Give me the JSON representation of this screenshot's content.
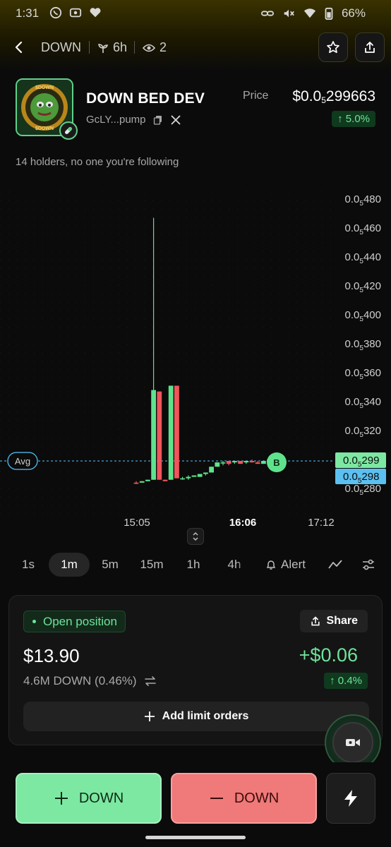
{
  "status_bar": {
    "time": "1:31",
    "battery": "66%",
    "left_icons": [
      "whatsapp-icon",
      "media-icon",
      "heart-icon"
    ],
    "right_icons": [
      "link-icon",
      "mute-icon",
      "wifi-icon",
      "battery-icon"
    ]
  },
  "header": {
    "ticker": "DOWN",
    "age": "6h",
    "watchers": "2",
    "buttons": [
      "back-icon",
      "star-icon",
      "share-icon"
    ]
  },
  "token": {
    "name": "DOWN BED DEV",
    "address": "GcLY...pump",
    "logo_text_top": "$DOWN",
    "logo_text_bottom": "$DOWN",
    "price_label": "Price",
    "price_prefix": "$0.0",
    "price_subscript": "5",
    "price_digits": "299663",
    "price_change": "↑ 5.0%",
    "holders_text": "14 holders, no one you're following"
  },
  "chart_data": {
    "type": "candlestick",
    "y_axis_prefix": "0.0",
    "y_axis_subscript": "5",
    "y_ticks": [
      "480",
      "460",
      "440",
      "420",
      "400",
      "380",
      "360",
      "340",
      "320",
      "300",
      "280"
    ],
    "ylim": [
      280,
      480
    ],
    "x_ticks": [
      "15:05",
      "16:06",
      "17:12"
    ],
    "x_tick_bold": "16:06",
    "avg_label": "Avg",
    "avg_value": 299,
    "marker_label": "B",
    "price_tags": [
      {
        "label": "299",
        "value": 299,
        "color": "#7de8a2"
      },
      {
        "label": "298",
        "value": 298,
        "color": "#5bc0f0"
      }
    ],
    "candles": [
      {
        "o": 284,
        "h": 285,
        "l": 283,
        "c": 284,
        "up": false
      },
      {
        "o": 284,
        "h": 285,
        "l": 284,
        "c": 285,
        "up": true
      },
      {
        "o": 285,
        "h": 286,
        "l": 285,
        "c": 286,
        "up": true
      },
      {
        "o": 286,
        "h": 467,
        "l": 286,
        "c": 348,
        "up": true
      },
      {
        "o": 347,
        "h": 347,
        "l": 286,
        "c": 286,
        "up": false
      },
      {
        "o": 286,
        "h": 286,
        "l": 285,
        "c": 285,
        "up": false
      },
      {
        "o": 286,
        "h": 351,
        "l": 286,
        "c": 351,
        "up": true
      },
      {
        "o": 351,
        "h": 351,
        "l": 287,
        "c": 287,
        "up": false
      },
      {
        "o": 287,
        "h": 288,
        "l": 286,
        "c": 287,
        "up": true
      },
      {
        "o": 287,
        "h": 289,
        "l": 286,
        "c": 288,
        "up": true
      },
      {
        "o": 288,
        "h": 289,
        "l": 288,
        "c": 289,
        "up": true
      },
      {
        "o": 288,
        "h": 290,
        "l": 288,
        "c": 290,
        "up": true
      },
      {
        "o": 290,
        "h": 291,
        "l": 289,
        "c": 291,
        "up": true
      },
      {
        "o": 291,
        "h": 295,
        "l": 291,
        "c": 295,
        "up": true
      },
      {
        "o": 295,
        "h": 298,
        "l": 295,
        "c": 298,
        "up": true
      },
      {
        "o": 298,
        "h": 299,
        "l": 296,
        "c": 298,
        "up": true
      },
      {
        "o": 299,
        "h": 299,
        "l": 296,
        "c": 297,
        "up": false
      },
      {
        "o": 298,
        "h": 299,
        "l": 297,
        "c": 299,
        "up": true
      },
      {
        "o": 299,
        "h": 299,
        "l": 297,
        "c": 297,
        "up": false
      },
      {
        "o": 298,
        "h": 299,
        "l": 297,
        "c": 299,
        "up": true
      },
      {
        "o": 299,
        "h": 300,
        "l": 298,
        "c": 298,
        "up": false
      },
      {
        "o": 298,
        "h": 299,
        "l": 297,
        "c": 297,
        "up": false
      },
      {
        "o": 297,
        "h": 299,
        "l": 297,
        "c": 299,
        "up": true
      },
      {
        "o": 299,
        "h": 300,
        "l": 298,
        "c": 300,
        "up": true
      },
      {
        "o": 299,
        "h": 300,
        "l": 298,
        "c": 299,
        "up": true
      }
    ],
    "colors": {
      "up": "#5ee38c",
      "down": "#f0555a",
      "avg": "#4fb3e8"
    }
  },
  "timeframes": {
    "items": [
      "1s",
      "1m",
      "5m",
      "15m",
      "1h",
      "4h"
    ],
    "active": "1m",
    "alert_label": "Alert"
  },
  "position": {
    "status_label": "Open position",
    "share_label": "Share",
    "value": "$13.90",
    "pnl": "+$0.06",
    "quantity": "4.6M DOWN (0.46%)",
    "pnl_pct": "↑ 0.4%",
    "limit_label": "Add limit orders"
  },
  "trade": {
    "buy_label": "DOWN",
    "sell_label": "DOWN",
    "colors": {
      "buy": "#7de8a2",
      "sell": "#f07979"
    }
  }
}
